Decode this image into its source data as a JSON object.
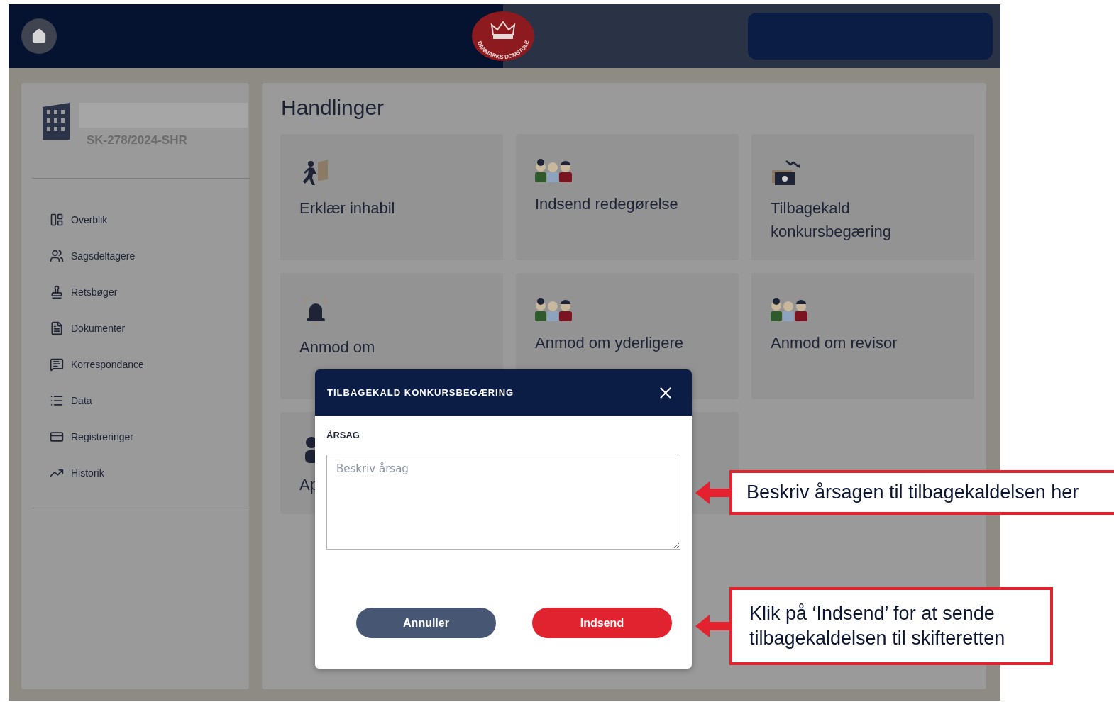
{
  "header": {
    "logo_text": "DANMARKS DOMSTOLE"
  },
  "case": {
    "number": "SK-278/2024-SHR"
  },
  "sidebar": {
    "items": [
      {
        "label": "Overblik"
      },
      {
        "label": "Sagsdeltagere"
      },
      {
        "label": "Retsbøger"
      },
      {
        "label": "Dokumenter"
      },
      {
        "label": "Korrespondance"
      },
      {
        "label": "Data"
      },
      {
        "label": "Registreringer"
      },
      {
        "label": "Historik"
      }
    ]
  },
  "main": {
    "title": "Handlinger",
    "cards": [
      {
        "kind": "action",
        "title": "Erklær inhabil"
      },
      {
        "kind": "action",
        "title": "Indsend redegørelse"
      },
      {
        "kind": "action",
        "title": "Tilbagekald konkursbegæring"
      },
      {
        "kind": "action",
        "title": "Anmod om"
      },
      {
        "kind": "action",
        "title": "Anmod om yderligere"
      },
      {
        "kind": "action",
        "title": "Anmod om revisor"
      },
      {
        "kind": "action",
        "title": "Ap"
      },
      {
        "kind": "blank"
      }
    ]
  },
  "dialog": {
    "title": "TILBAGEKALD KONKURSBEGÆRING",
    "field_label": "ÅRSAG",
    "placeholder": "Beskriv årsag",
    "buttons": [
      {
        "label": "Annuller",
        "kind": "secondary"
      },
      {
        "label": "Indsend",
        "kind": "primary"
      }
    ]
  },
  "callouts": [
    {
      "text": "Beskriv årsagen til tilbagekaldelsen her"
    },
    {
      "text": "Klik på ‘Indsend’ for at sende tilbagekaldelsen til skifteretten"
    }
  ]
}
